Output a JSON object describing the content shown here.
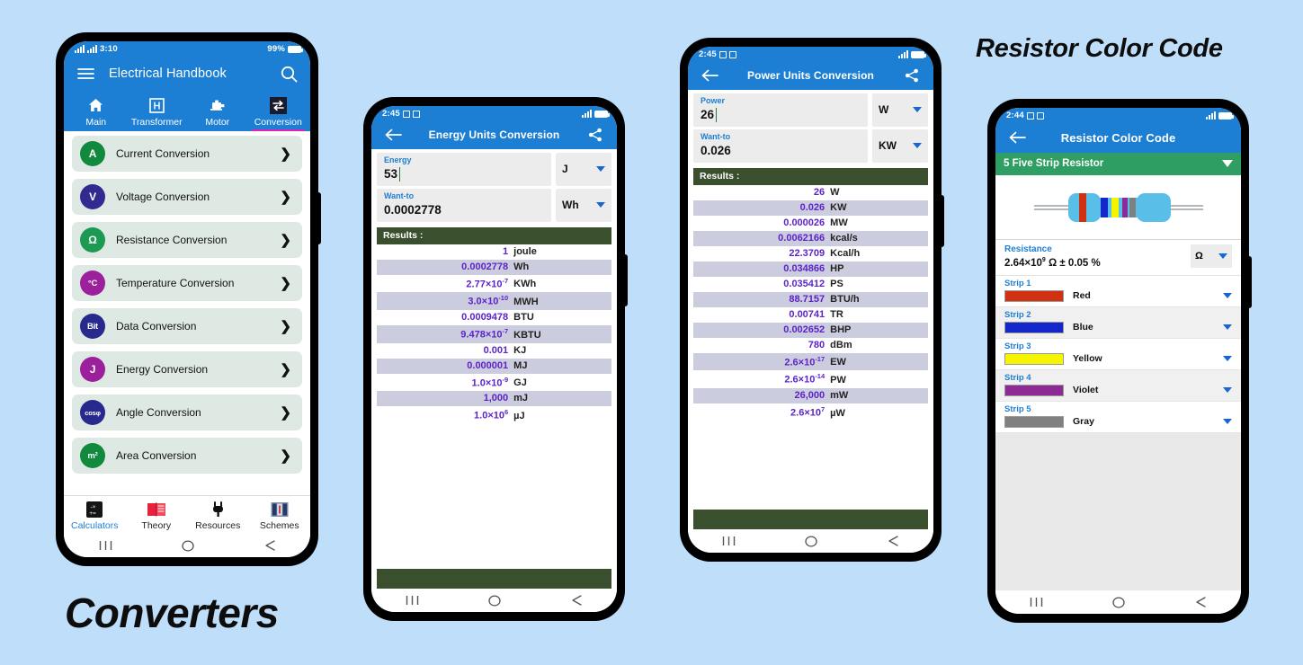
{
  "captions": {
    "converters": "Converters",
    "resistor": "Resistor Color Code"
  },
  "colors": {
    "app_blue": "#1d7fd4",
    "accent_pink": "#e020b8",
    "results_green": "#3a4f2d",
    "select_green": "#2e9e63",
    "value_purple": "#5b23c9",
    "page_background": "#bfdefa"
  },
  "phone1": {
    "status": {
      "time": "3:10",
      "battery_percent": "99%"
    },
    "appbar": {
      "menu_icon": "hamburger-menu-icon",
      "title": "Electrical Handbook",
      "search_icon": "search-icon"
    },
    "tabs": [
      {
        "label": "Main",
        "icon": "home-icon",
        "active": false
      },
      {
        "label": "Transformer",
        "icon": "transformer-icon",
        "active": false
      },
      {
        "label": "Motor",
        "icon": "motor-icon",
        "active": false
      },
      {
        "label": "Conversion",
        "icon": "conversion-arrows-icon",
        "active": true
      }
    ],
    "list": [
      {
        "badge": "A",
        "badge_color": "#128a3e",
        "label": "Current Conversion"
      },
      {
        "badge": "V",
        "badge_color": "#312b8f",
        "label": "Voltage Conversion"
      },
      {
        "badge": "Ω",
        "badge_color": "#1c9a52",
        "label": "Resistance Conversion"
      },
      {
        "badge": "°C",
        "badge_color": "#9c1f9c",
        "label": "Temperature Conversion"
      },
      {
        "badge": "Bit",
        "badge_color": "#272a8c",
        "label": "Data Conversion"
      },
      {
        "badge": "J",
        "badge_color": "#9c1f9c",
        "label": "Energy Conversion"
      },
      {
        "badge": "cosφ",
        "badge_color": "#272a8c",
        "label": "Angle Conversion"
      },
      {
        "badge": "m²",
        "badge_color": "#128a3e",
        "label": "Area Conversion"
      }
    ],
    "bottom_nav": [
      {
        "label": "Calculators",
        "icon": "calculator-icon",
        "active": true
      },
      {
        "label": "Theory",
        "icon": "book-icon",
        "active": false
      },
      {
        "label": "Resources",
        "icon": "plug-icon",
        "active": false
      },
      {
        "label": "Schemes",
        "icon": "schematic-icon",
        "active": false
      }
    ]
  },
  "phone2": {
    "status": {
      "time": "2:45"
    },
    "appbar": {
      "back_icon": "back-arrow-icon",
      "title": "Energy Units Conversion",
      "share_icon": "share-icon"
    },
    "input": {
      "label": "Energy",
      "value": "53",
      "unit": "J"
    },
    "output": {
      "label": "Want-to",
      "value": "0.0002778",
      "unit": "Wh"
    },
    "results_header": "Results :",
    "results": [
      {
        "value": "1",
        "unit": "joule"
      },
      {
        "value": "0.0002778",
        "unit": "Wh"
      },
      {
        "value": "2.77×10",
        "exp": "-7",
        "unit": "KWh"
      },
      {
        "value": "3.0×10",
        "exp": "-10",
        "unit": "MWH"
      },
      {
        "value": "0.0009478",
        "unit": "BTU"
      },
      {
        "value": "9.478×10",
        "exp": "-7",
        "unit": "KBTU"
      },
      {
        "value": "0.001",
        "unit": "KJ"
      },
      {
        "value": "0.000001",
        "unit": "MJ"
      },
      {
        "value": "1.0×10",
        "exp": "-9",
        "unit": "GJ"
      },
      {
        "value": "1,000",
        "unit": "mJ"
      },
      {
        "value": "1.0×10",
        "exp": "6",
        "unit": "µJ"
      }
    ]
  },
  "phone3": {
    "status": {
      "time": "2:45"
    },
    "appbar": {
      "back_icon": "back-arrow-icon",
      "title": "Power Units Conversion",
      "share_icon": "share-icon"
    },
    "input": {
      "label": "Power",
      "value": "26",
      "unit": "W"
    },
    "output": {
      "label": "Want-to",
      "value": "0.026",
      "unit": "KW"
    },
    "results_header": "Results :",
    "results": [
      {
        "value": "26",
        "unit": "W"
      },
      {
        "value": "0.026",
        "unit": "KW"
      },
      {
        "value": "0.000026",
        "unit": "MW"
      },
      {
        "value": "0.0062166",
        "unit": "kcal/s"
      },
      {
        "value": "22.3709",
        "unit": "Kcal/h"
      },
      {
        "value": "0.034866",
        "unit": "HP"
      },
      {
        "value": "0.035412",
        "unit": "PS"
      },
      {
        "value": "88.7157",
        "unit": "BTU/h"
      },
      {
        "value": "0.00741",
        "unit": "TR"
      },
      {
        "value": "0.002652",
        "unit": "BHP"
      },
      {
        "value": "780",
        "unit": "dBm"
      },
      {
        "value": "2.6×10",
        "exp": "-17",
        "unit": "EW"
      },
      {
        "value": "2.6×10",
        "exp": "-14",
        "unit": "PW"
      },
      {
        "value": "26,000",
        "unit": "mW"
      },
      {
        "value": "2.6×10",
        "exp": "7",
        "unit": "µW"
      }
    ]
  },
  "phone4": {
    "status": {
      "time": "2:44"
    },
    "appbar": {
      "back_icon": "back-arrow-icon",
      "title": "Resistor Color Code"
    },
    "type_select": "5 Five Strip Resistor",
    "resistance": {
      "label": "Resistance",
      "value": "2.64×10",
      "exp": "9",
      "suffix": "Ω  ± 0.05 %",
      "unit": "Ω"
    },
    "strips": [
      {
        "label": "Strip 1",
        "color": "#cf3111",
        "name": "Red"
      },
      {
        "label": "Strip 2",
        "color": "#1226cc",
        "name": "Blue"
      },
      {
        "label": "Strip 3",
        "color": "#f7f400",
        "name": "Yellow"
      },
      {
        "label": "Strip 4",
        "color": "#8c2a96",
        "name": "Violet"
      },
      {
        "label": "Strip 5",
        "color": "#808080",
        "name": "Gray"
      }
    ],
    "resistor_bands": [
      "#cf3111",
      "#1226cc",
      "#f7f400",
      "#8c2a96",
      "#808080"
    ]
  },
  "navbar": {
    "recents": "recents-icon",
    "home": "home-circle-icon",
    "back": "back-chevron-icon"
  }
}
